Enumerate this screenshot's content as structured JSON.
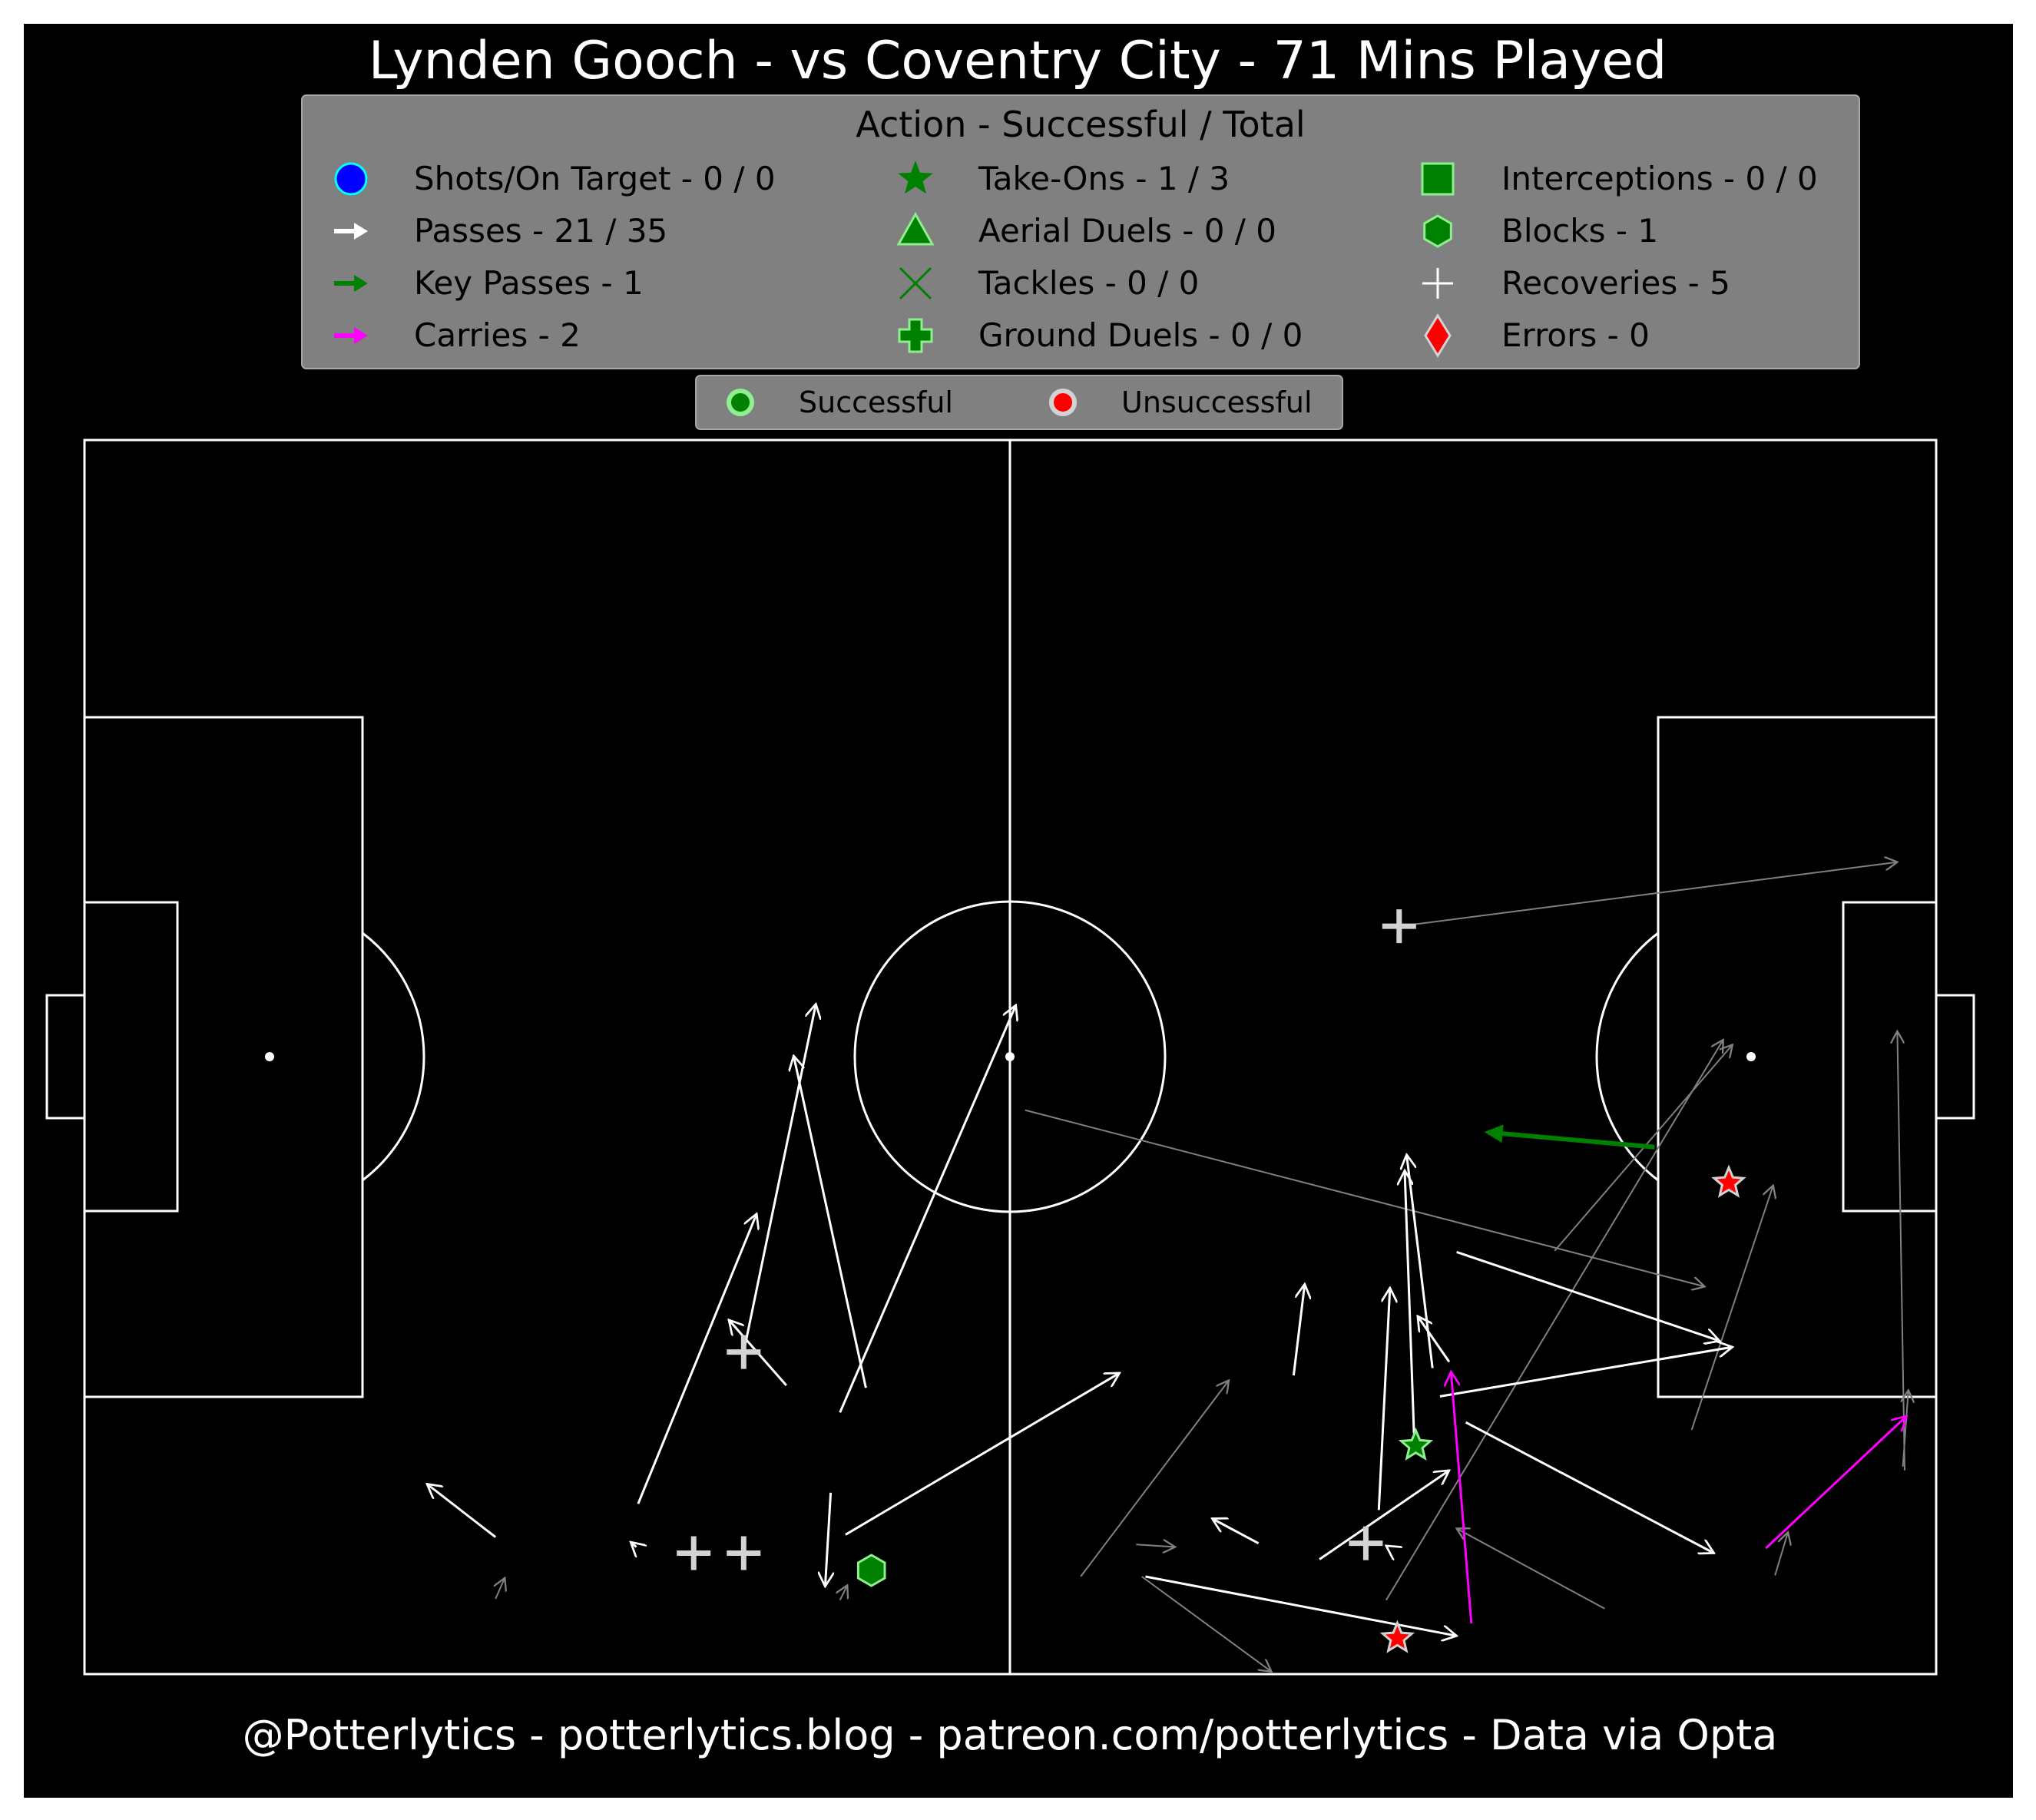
{
  "title": "Lynden Gooch - vs Coventry City - 71 Mins Played",
  "footer": "@Potterlytics - potterlytics.blog - patreon.com/potterlytics - Data via Opta",
  "colors": {
    "background": "#000000",
    "legend_bg": "#808080",
    "pitch_lines": "#ffffff",
    "successful_pass": "#ffffff",
    "unsuccessful_pass": "#808080",
    "key_pass": "#008000",
    "carry": "#ff00ff",
    "success_fill": "#008000",
    "success_edge": "#90ee90",
    "fail_fill": "#ff0000",
    "fail_edge": "#d3d3d3",
    "recovery": "#d3d3d3"
  },
  "legend": {
    "title": "Action - Successful / Total",
    "columns": [
      [
        {
          "icon": "circle-blue-icon",
          "label": "Shots/On Target - 0 / 0"
        },
        {
          "icon": "arrow-white-icon",
          "label": "Passes - 21 / 35"
        },
        {
          "icon": "arrow-green-icon",
          "label": "Key Passes - 1"
        },
        {
          "icon": "arrow-magenta-icon",
          "label": "Carries - 2"
        }
      ],
      [
        {
          "icon": "star-icon",
          "label": "Take-Ons - 1 / 3"
        },
        {
          "icon": "triangle-icon",
          "label": "Aerial Duels - 0 / 0"
        },
        {
          "icon": "x-icon",
          "label": "Tackles - 0 / 0"
        },
        {
          "icon": "plus-filled-icon",
          "label": "Ground Duels - 0 / 0"
        }
      ],
      [
        {
          "icon": "square-icon",
          "label": "Interceptions - 0 / 0"
        },
        {
          "icon": "hexagon-icon",
          "label": "Blocks - 1"
        },
        {
          "icon": "plus-icon",
          "label": "Recoveries - 5"
        },
        {
          "icon": "diamond-icon",
          "label": "Errors - 0"
        }
      ]
    ]
  },
  "outcome_legend": {
    "successful": "Successful",
    "unsuccessful": "Unsuccessful"
  },
  "chart_data": {
    "type": "scatter",
    "pitch": {
      "length": 100,
      "width": 100,
      "attacking_direction": "left-to-right"
    },
    "passes_successful": [
      {
        "from": [
          22.2,
          11.1
        ],
        "to": [
          18.5,
          15.4
        ]
      },
      {
        "from": [
          29.8,
          10.3
        ],
        "to": [
          29.5,
          10.7
        ]
      },
      {
        "from": [
          29.9,
          13.8
        ],
        "to": [
          36.3,
          37.3
        ]
      },
      {
        "from": [
          35.6,
          26.1
        ],
        "to": [
          39.5,
          54.3
        ]
      },
      {
        "from": [
          37.9,
          23.4
        ],
        "to": [
          34.8,
          28.7
        ]
      },
      {
        "from": [
          42.2,
          23.2
        ],
        "to": [
          38.3,
          50.1
        ]
      },
      {
        "from": [
          40.8,
          21.2
        ],
        "to": [
          50.3,
          54.2
        ]
      },
      {
        "from": [
          40.3,
          14.7
        ],
        "to": [
          40.0,
          7.1
        ]
      },
      {
        "from": [
          41.1,
          11.3
        ],
        "to": [
          55.9,
          24.4
        ]
      },
      {
        "from": [
          63.4,
          10.6
        ],
        "to": [
          60.9,
          12.6
        ]
      },
      {
        "from": [
          65.3,
          24.2
        ],
        "to": [
          65.9,
          31.6
        ]
      },
      {
        "from": [
          66.7,
          9.3
        ],
        "to": [
          73.7,
          16.5
        ]
      },
      {
        "from": [
          69.9,
          13.3
        ],
        "to": [
          70.5,
          31.3
        ]
      },
      {
        "from": [
          71.8,
          19.5
        ],
        "to": [
          71.3,
          40.8
        ]
      },
      {
        "from": [
          73.7,
          25.3
        ],
        "to": [
          72.0,
          29.0
        ]
      },
      {
        "from": [
          73.2,
          22.5
        ],
        "to": [
          89.0,
          26.5
        ]
      },
      {
        "from": [
          74.1,
          34.2
        ],
        "to": [
          88.3,
          27.0
        ]
      },
      {
        "from": [
          74.6,
          20.4
        ],
        "to": [
          88.0,
          9.8
        ]
      },
      {
        "from": [
          72.8,
          24.8
        ],
        "to": [
          71.4,
          42.1
        ]
      },
      {
        "from": [
          57.3,
          7.9
        ],
        "to": [
          74.1,
          3.1
        ]
      },
      {
        "from": [
          70.4,
          10.3
        ],
        "to": [
          70.3,
          10.4
        ]
      }
    ],
    "passes_unsuccessful": [
      {
        "from": [
          22.2,
          6.1
        ],
        "to": [
          22.7,
          7.8
        ]
      },
      {
        "from": [
          40.8,
          6.0
        ],
        "to": [
          41.2,
          7.2
        ]
      },
      {
        "from": [
          50.8,
          45.7
        ],
        "to": [
          87.5,
          31.4
        ]
      },
      {
        "from": [
          53.8,
          7.9
        ],
        "to": [
          61.8,
          23.8
        ]
      },
      {
        "from": [
          56.8,
          10.5
        ],
        "to": [
          58.9,
          10.3
        ]
      },
      {
        "from": [
          57.1,
          7.9
        ],
        "to": [
          64.1,
          0.2
        ]
      },
      {
        "from": [
          70.3,
          6.0
        ],
        "to": [
          88.5,
          51.4
        ]
      },
      {
        "from": [
          79.4,
          34.3
        ],
        "to": [
          89.0,
          51.0
        ]
      },
      {
        "from": [
          82.1,
          5.3
        ],
        "to": [
          74.1,
          11.8
        ]
      },
      {
        "from": [
          86.8,
          19.8
        ],
        "to": [
          91.2,
          39.6
        ]
      },
      {
        "from": [
          91.3,
          8.0
        ],
        "to": [
          92.0,
          11.5
        ]
      },
      {
        "from": [
          71.0,
          60.6
        ],
        "to": [
          97.9,
          65.8
        ]
      },
      {
        "from": [
          98.3,
          16.5
        ],
        "to": [
          97.9,
          52.1
        ]
      },
      {
        "from": [
          98.2,
          16.8
        ],
        "to": [
          98.5,
          23.0
        ]
      }
    ],
    "key_passes": [
      {
        "from": [
          84.8,
          42.7
        ],
        "to": [
          75.8,
          43.9
        ]
      }
    ],
    "carries": [
      {
        "from": [
          74.9,
          4.1
        ],
        "to": [
          73.8,
          24.5
        ]
      },
      {
        "from": [
          90.8,
          10.2
        ],
        "to": [
          98.4,
          20.9
        ]
      }
    ],
    "take_ons": [
      {
        "x": 71.9,
        "y": 18.5,
        "outcome": "successful"
      },
      {
        "x": 88.8,
        "y": 39.8,
        "outcome": "unsuccessful"
      },
      {
        "x": 70.9,
        "y": 2.9,
        "outcome": "unsuccessful"
      }
    ],
    "blocks": [
      {
        "x": 42.5,
        "y": 8.4
      }
    ],
    "recoveries": [
      {
        "x": 71.0,
        "y": 60.6
      },
      {
        "x": 35.6,
        "y": 26.1
      },
      {
        "x": 32.9,
        "y": 9.8
      },
      {
        "x": 35.6,
        "y": 9.8
      },
      {
        "x": 69.2,
        "y": 10.6
      }
    ]
  }
}
